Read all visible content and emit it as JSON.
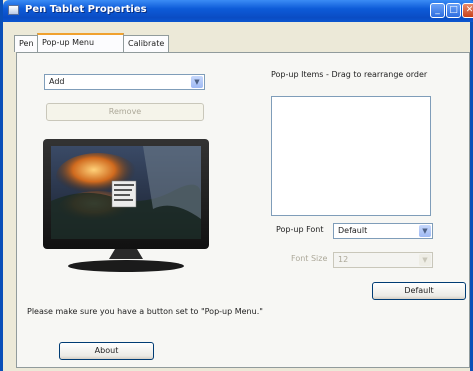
{
  "window": {
    "title": "Pen Tablet Properties"
  },
  "title_buttons": {
    "minimize": "_",
    "maximize": "□",
    "close": "✕"
  },
  "tabs": [
    {
      "label": "Pen"
    },
    {
      "label": "Pop-up Menu"
    },
    {
      "label": "Calibrate"
    }
  ],
  "action_select": {
    "value": "Add"
  },
  "remove_button": {
    "label": "Remove"
  },
  "popup_items": {
    "label": "Pop-up Items - Drag to rearrange order"
  },
  "popup_font": {
    "label": "Pop-up Font",
    "value": "Default"
  },
  "font_size": {
    "label": "Font Size",
    "value": "12"
  },
  "default_button": {
    "label": "Default"
  },
  "note": "Please make sure you have a button set to \"Pop-up Menu.\"",
  "about_button": {
    "label": "About"
  },
  "colors": {
    "accent": "#0a4cc4",
    "tab_highlight": "#f0a12e",
    "face": "#ece9d8"
  }
}
